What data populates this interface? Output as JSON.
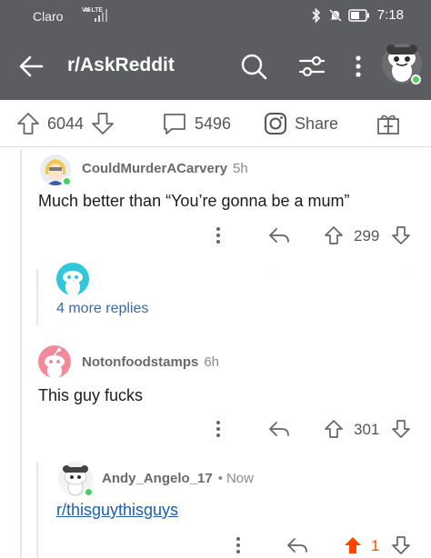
{
  "status_bar": {
    "carrier": "Claro",
    "network": "Vo LTE",
    "network_sub": "46",
    "time": "7:18"
  },
  "header": {
    "subreddit": "r/AskReddit",
    "icons": [
      "back-arrow-icon",
      "search-icon",
      "filter-icon",
      "more-vertical-icon",
      "snoo-avatar-icon"
    ]
  },
  "post_actions": {
    "upvotes": "6044",
    "comments": "5496",
    "share_label": "Share"
  },
  "comments": [
    {
      "author": "CouldMurderACarvery",
      "age": "5h",
      "text": "Much better than “You’re gonna be a mum”",
      "votes": "299"
    },
    {
      "more_replies": "4 more replies"
    },
    {
      "author": "Notonfoodstamps",
      "age": "6h",
      "text": "This guy fucks",
      "votes": "301"
    },
    {
      "author": "Andy_Angelo_17",
      "separator": "•",
      "age": "Now",
      "text": "r/thisguythisguys",
      "votes": "1"
    }
  ],
  "colors": {
    "app_bar": "#5b5d60",
    "upvote_active": "#ff4500",
    "link": "#1a5fb4",
    "online": "#46d160",
    "teal_avatar": "#2fc7d9",
    "pink_avatar": "#f28a9a"
  }
}
